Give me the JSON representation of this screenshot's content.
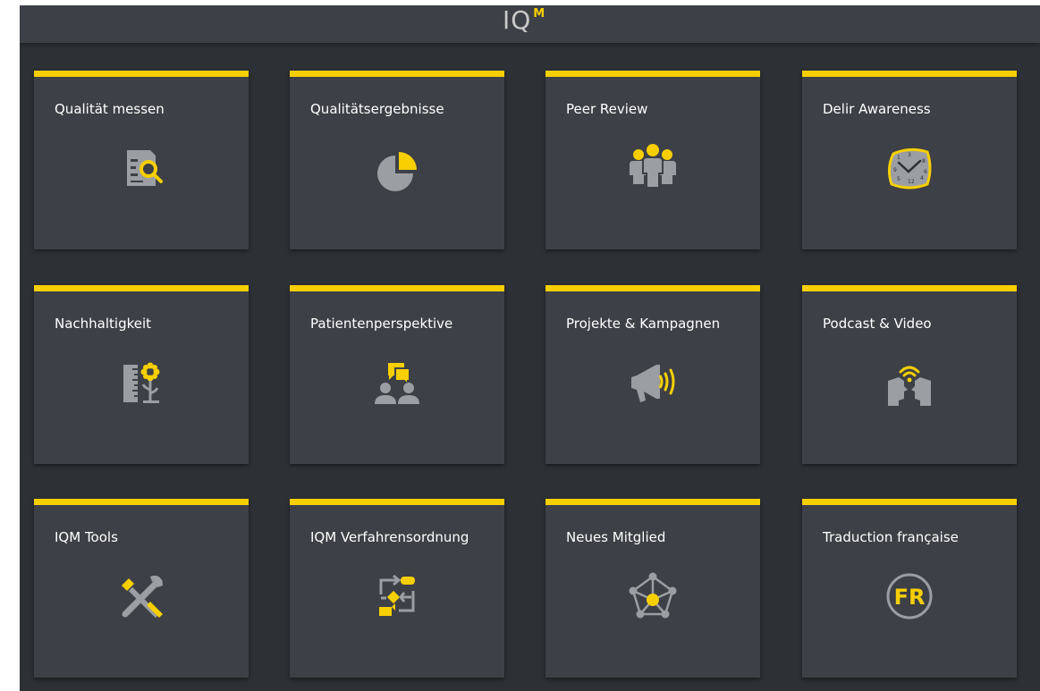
{
  "header": {
    "logo_text": "IQ",
    "logo_superscript": "M"
  },
  "colors": {
    "accent": "#f7cf00",
    "tile_background": "#3d4046",
    "page_background": "#2d3035",
    "icon_gray": "#9b9ea3"
  },
  "tiles": [
    {
      "label": "Qualität messen",
      "icon": "document-search-icon"
    },
    {
      "label": "Qualitätsergebnisse",
      "icon": "pie-chart-icon"
    },
    {
      "label": "Peer Review",
      "icon": "people-group-icon"
    },
    {
      "label": "Delir Awareness",
      "icon": "distorted-clock-icon"
    },
    {
      "label": "Nachhaltigkeit",
      "icon": "ruler-flower-icon"
    },
    {
      "label": "Patientenperspektive",
      "icon": "people-chat-icon"
    },
    {
      "label": "Projekte & Kampagnen",
      "icon": "megaphone-icon"
    },
    {
      "label": "Podcast & Video",
      "icon": "faces-broadcast-icon"
    },
    {
      "label": "IQM Tools",
      "icon": "tools-icon"
    },
    {
      "label": "IQM Verfahrensordnung",
      "icon": "process-flow-icon"
    },
    {
      "label": "Neues Mitglied",
      "icon": "network-node-icon"
    },
    {
      "label": "Traduction française",
      "icon": "fr-circle-icon"
    }
  ]
}
